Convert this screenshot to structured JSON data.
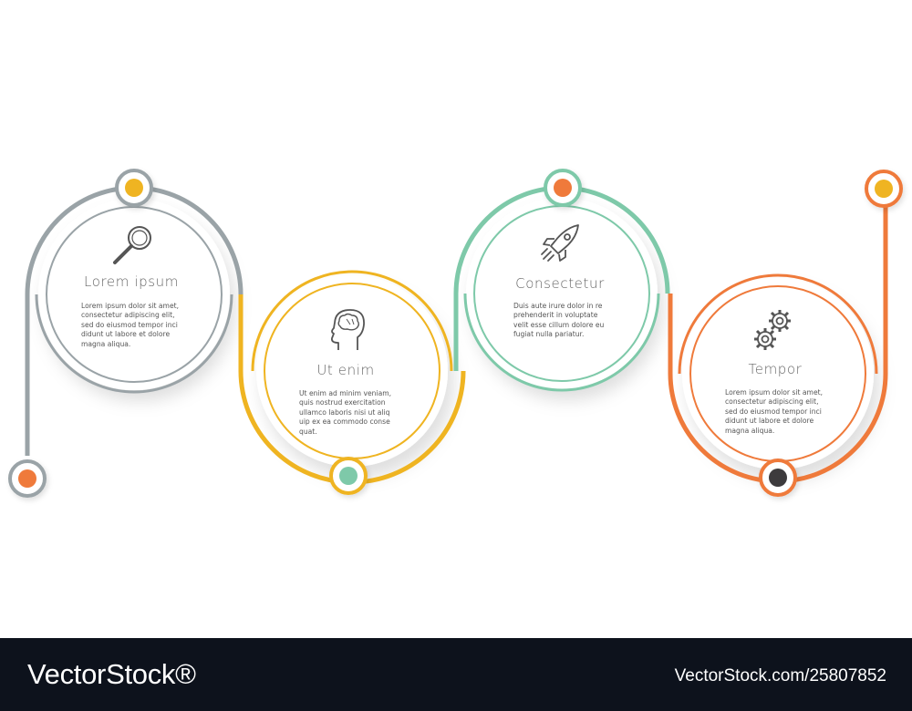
{
  "colors": {
    "gray": "#9aa3a7",
    "yellow": "#efb421",
    "teal": "#7ec9a9",
    "orange": "#ef7a3b",
    "dark": "#3d3b3e",
    "text": "#555555"
  },
  "steps": [
    {
      "title": "Lorem ipsum",
      "icon": "magnifier-icon",
      "lines": [
        "Lorem ipsum dolor sit amet,",
        "consectetur adipiscing elit,",
        "sed do eiusmod tempor inci",
        "didunt ut labore et dolore",
        "magna aliqua."
      ]
    },
    {
      "title": "Ut enim",
      "icon": "brain-head-icon",
      "lines": [
        "Ut enim ad minim veniam,",
        "quis nostrud exercitation",
        "ullamco laboris nisi ut aliq",
        "uip ex ea commodo conse",
        "quat."
      ]
    },
    {
      "title": "Consectetur",
      "icon": "rocket-icon",
      "lines": [
        "Duis aute irure dolor in re",
        "prehenderit in voluptate",
        "velit esse cillum dolore eu",
        "fugiat nulla pariatur."
      ]
    },
    {
      "title": "Tempor",
      "icon": "gears-icon",
      "lines": [
        "Lorem ipsum dolor sit amet,",
        "consectetur adipiscing elit,",
        "sed do eiusmod tempor inci",
        "didunt ut labore et dolore",
        "magna aliqua."
      ]
    }
  ],
  "footer": {
    "logo": "VectorStock®",
    "id": "VectorStock.com/25807852"
  }
}
